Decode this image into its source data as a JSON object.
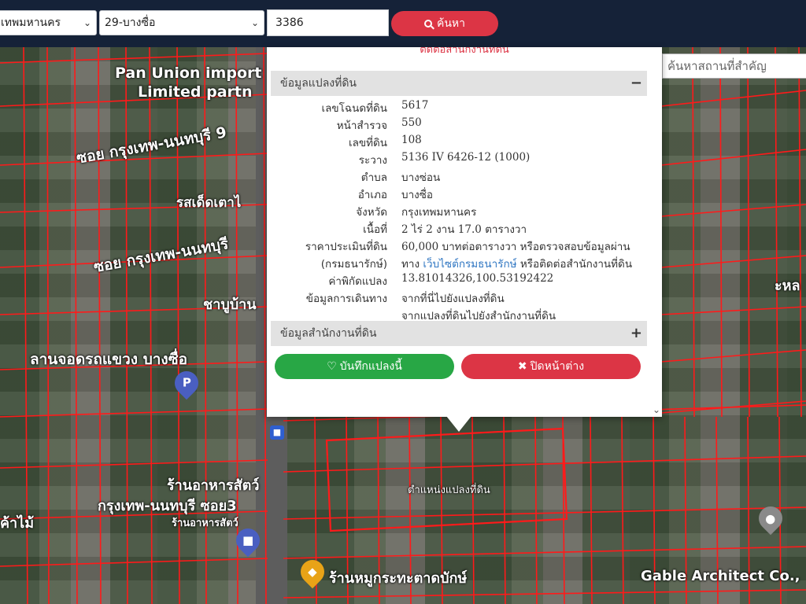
{
  "search": {
    "province": "เทพมหานคร",
    "district": "29-บางซื่อ",
    "deed_number": "3386",
    "search_label": "ค้นหา"
  },
  "landmark_search": {
    "placeholder": "ค้นหาสถานที่สำคัญ"
  },
  "map_labels": {
    "pan_union": "Pan Union import",
    "limited": "Limited partn",
    "soi_1": "ซอย กรุงเทพ-นนทบุรี 9",
    "soi_2": "ซอย กรุงเทพ-นนทบุรี",
    "restaurant_1": "รสเด็ดเตาไ",
    "chabu": "ชาบูบ้าน",
    "parking": "ลานจอดรถแขวง บางซื่อ",
    "food_shop": "ร้านอาหารสัตว์",
    "soi_3": "กรุงเทพ-นนทบุรี ซอย3",
    "food_shop_2": "ร้านอาหารสัตว์",
    "plot_location": "ตำแหน่งแปลงที่ดิน",
    "mookata": "ร้านหมูกระทะตาดบักษ์",
    "gable": "Gable Architect Co.,",
    "left_edge": "ค้าไม้",
    "right_edge": "ะหล"
  },
  "popup": {
    "top_cut_text": "ติดต่อสำนักงานที่ดิน",
    "section_land": "ข้อมูลแปลงที่ดิน",
    "section_land_toggle": "−",
    "section_office": "ข้อมูลสำนักงานที่ดิน",
    "section_office_toggle": "+",
    "fields": {
      "deed_label": "เลขโฉนดที่ดิน",
      "deed_value": "5617",
      "survey_label": "หน้าสำรวจ",
      "survey_value": "550",
      "parcel_label": "เลขที่ดิน",
      "parcel_value": "108",
      "sheet_label": "ระวาง",
      "sheet_value": "5136 IV 6426-12 (1000)",
      "subdistrict_label": "ตำบล",
      "subdistrict_value": "บางซ่อน",
      "district_label": "อำเภอ",
      "district_value": "บางซื่อ",
      "province_label": "จังหวัด",
      "province_value": "กรุงเทพมหานคร",
      "area_label": "เนื้อที่",
      "area_value": "2 ไร่ 2 งาน 17.0 ตารางวา",
      "price_label": "ราคาประเมินที่ดิน",
      "price_value": "60,000 บาทต่อตารางวา หรือตรวจสอบข้อมูลผ่าน",
      "dept_label": "(กรมธนารักษ์)",
      "dept_prefix": "ทาง",
      "dept_link": "เว็บไซต์กรมธนารักษ์",
      "dept_suffix": "หรือติดต่อสำนักงานที่ดิน",
      "coord_label": "ค่าพิกัดแปลง",
      "coord_value": "13.81014326,100.53192422",
      "travel_label": "ข้อมูลการเดินทาง",
      "travel_link_1": "จากที่นี่ไปยังแปลงที่ดิน",
      "travel_link_2": "จากแปลงที่ดินไปยังสำนักงานที่ดิน"
    },
    "save_label": "บันทึกแปลงนี้",
    "close_label": "ปิดหน้าต่าง"
  },
  "colors": {
    "topbar": "#152238",
    "danger": "#dc3545",
    "success": "#28a745",
    "link": "#2f76c2",
    "parcel_line": "#ff1a1a"
  }
}
